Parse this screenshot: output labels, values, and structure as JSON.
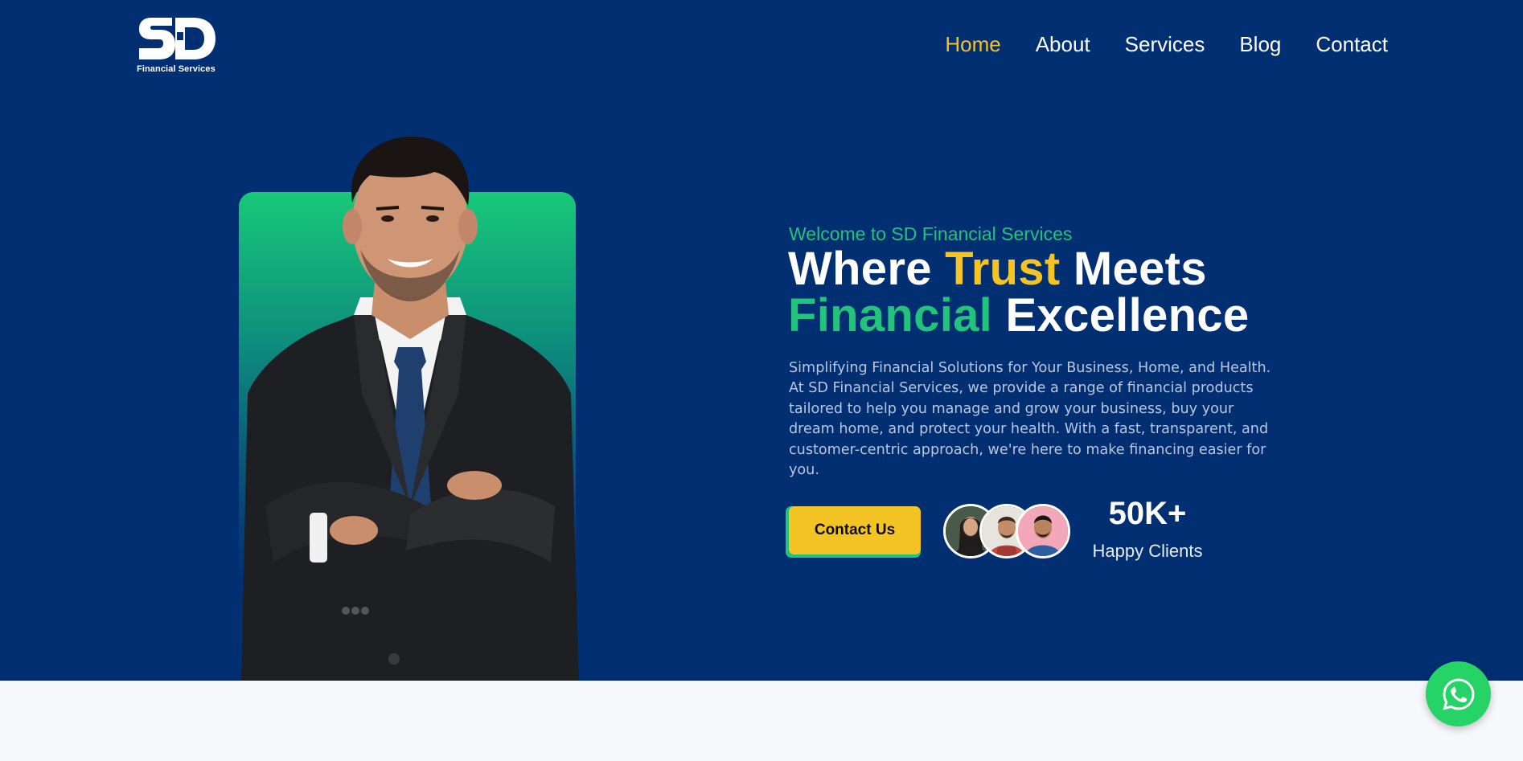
{
  "logo": {
    "subtitle": "Financial Services"
  },
  "nav": {
    "items": [
      {
        "label": "Home",
        "active": true
      },
      {
        "label": "About",
        "active": false
      },
      {
        "label": "Services",
        "active": false
      },
      {
        "label": "Blog",
        "active": false
      },
      {
        "label": "Contact",
        "active": false
      }
    ]
  },
  "hero": {
    "welcome": "Welcome to SD Financial Services",
    "headline": {
      "part1": "Where ",
      "highlight1": "Trust",
      "part2": " Meets",
      "highlight2": "Financial",
      "part3": " Excellence"
    },
    "description": "Simplifying Financial Solutions for Your Business, Home, and Health. At SD Financial Services, we provide a range of financial products tailored to help you manage and grow your business, buy your dream home, and protect your health. With a fast, transparent, and customer-centric approach, we're here to make financing easier for you.",
    "cta_label": "Contact Us",
    "stats": {
      "value": "50K+",
      "label": "Happy Clients"
    }
  },
  "colors": {
    "background": "#012f72",
    "accent_yellow": "#f4c425",
    "accent_green": "#22c37a",
    "whatsapp": "#25d366"
  },
  "icons": {
    "float_button": "whatsapp-icon"
  }
}
